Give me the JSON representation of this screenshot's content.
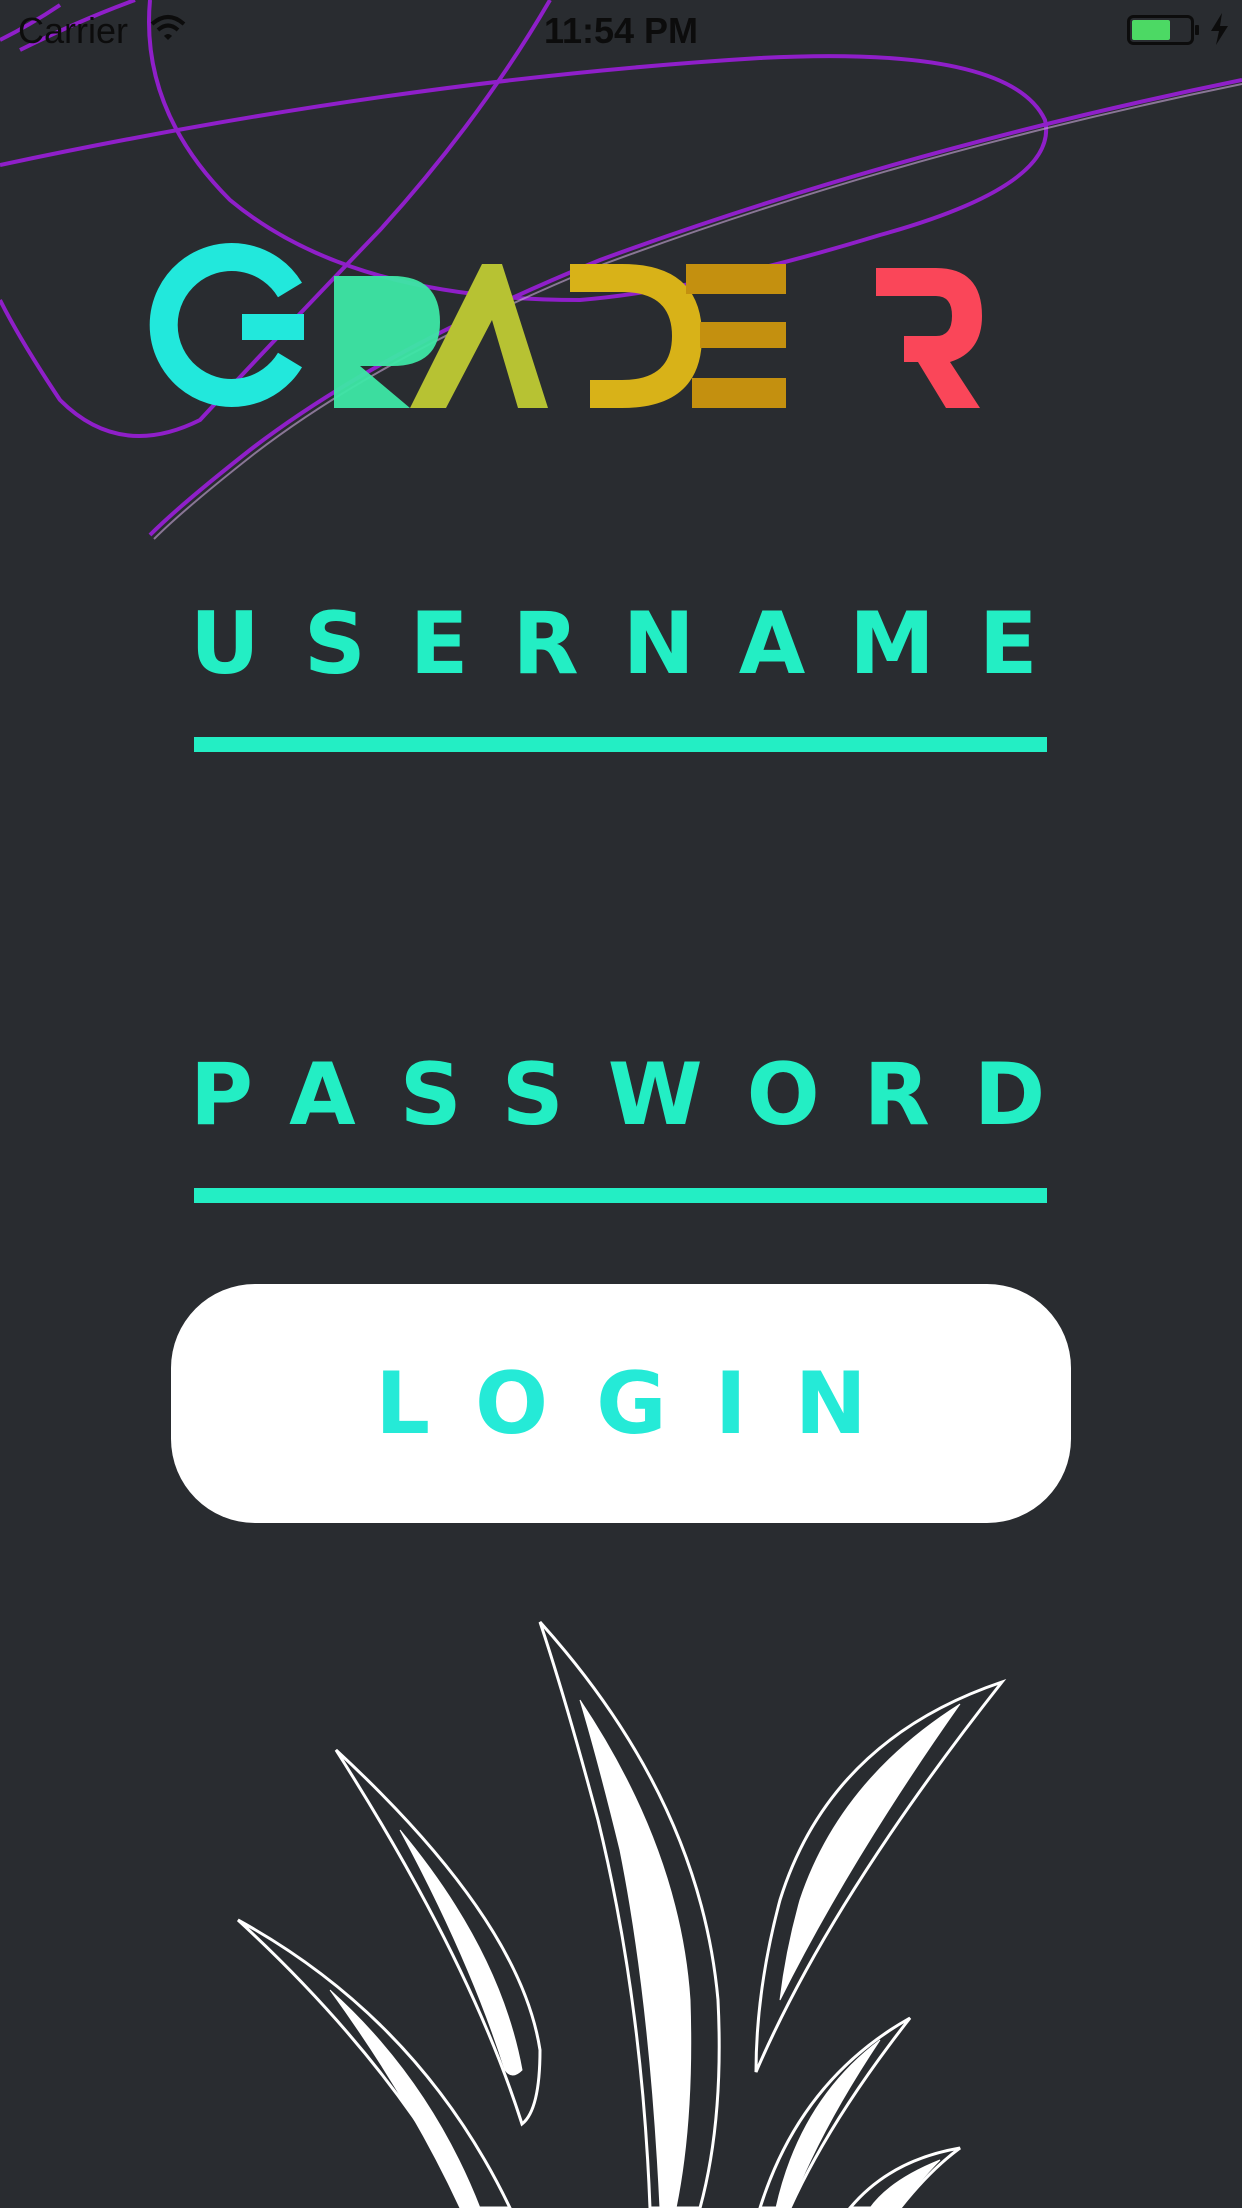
{
  "status_bar": {
    "carrier": "Carrier",
    "time": "11:54 PM",
    "wifi_icon": "wifi-icon",
    "battery_icon": "battery-icon",
    "charging_icon": "bolt-icon"
  },
  "logo": {
    "letters": [
      {
        "char": "G",
        "color": "#22e8dc"
      },
      {
        "char": "R",
        "color": "#3de7a5"
      },
      {
        "char": "A",
        "color": "#b7c233"
      },
      {
        "char": "D",
        "color": "#d8b218"
      },
      {
        "char": "E",
        "color": "#c4900f"
      },
      {
        "char": "R",
        "color": "#fa4659"
      }
    ]
  },
  "form": {
    "username_label": "USERNAME",
    "username_value": "",
    "password_label": "PASSWORD",
    "password_value": "",
    "login_label": "LOGIN"
  },
  "colors": {
    "background": "#292c30",
    "accent": "#23eec4",
    "scribble": "#8f1fc9",
    "button": "#ffffff"
  }
}
